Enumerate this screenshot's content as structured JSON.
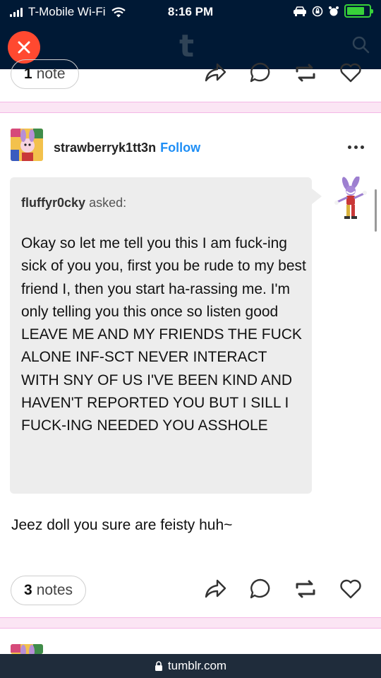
{
  "status_bar": {
    "carrier": "T-Mobile Wi-Fi",
    "time": "8:16 PM"
  },
  "app_header": {
    "logo": "t",
    "close_icon": "close-icon",
    "search_icon": "search-icon",
    "accent_color": "#ff4930",
    "background_color": "#001935"
  },
  "previous_post": {
    "notes_count": "1",
    "notes_label": "note"
  },
  "post": {
    "username": "strawberryk1tt3n",
    "follow_label": "Follow",
    "asker_name": "fluffyr0cky",
    "asked_label": "asked:",
    "question": "Okay so let me tell you this I am fuck-ing sick of you you, first you be rude to my best friend I, then you start ha-rassing me. I'm only telling you this once so listen good LEAVE ME AND MY FRIENDS THE FUCK ALONE INF-SCT NEVER INTERACT WITH SNY OF US I'VE BEEN KIND AND HAVEN'T REPORTED YOU BUT I SILL I FUCK-ING NEEDED YOU ASSHOLE",
    "answer": "Jeez doll you sure are feisty huh~",
    "notes_count": "3",
    "notes_label": "notes"
  },
  "bottom_bar": {
    "url": "tumblr.com"
  }
}
